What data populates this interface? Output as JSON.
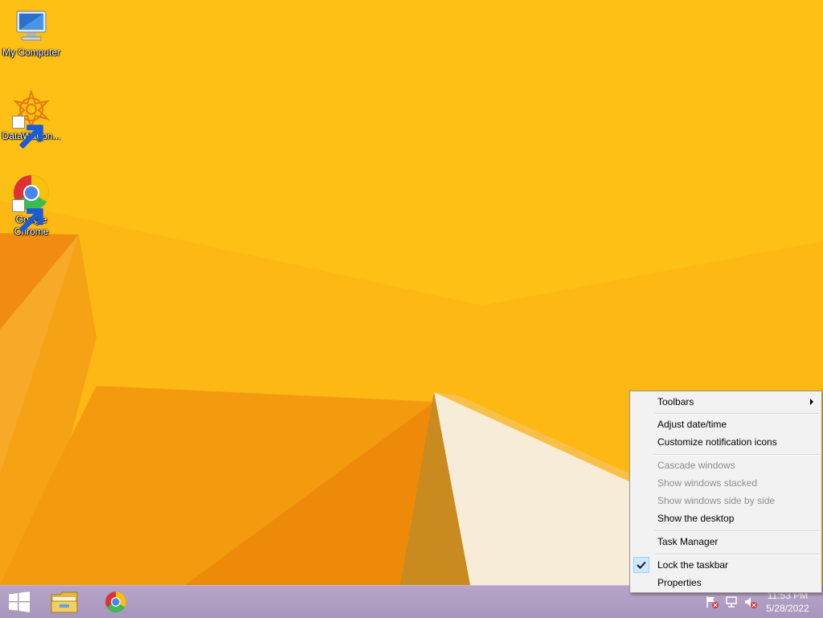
{
  "desktop": {
    "icons": [
      {
        "label": "My Computer",
        "icon": "computer-icon"
      },
      {
        "label": "DataWagon...",
        "icon": "datawagon-icon"
      },
      {
        "label": "Google Chrome",
        "icon": "chrome-icon"
      }
    ]
  },
  "taskbar": {
    "start_icon": "windows-start-icon",
    "pinned": [
      {
        "icon": "file-explorer-icon"
      },
      {
        "icon": "chrome-icon"
      }
    ],
    "tray": {
      "icons": [
        "action-center-flag-icon",
        "network-icon",
        "volume-muted-icon"
      ],
      "time": "11:53 PM",
      "date": "5/28/2022"
    }
  },
  "context_menu": {
    "items": [
      {
        "label": "Toolbars",
        "enabled": true,
        "submenu": true
      },
      {
        "label": "Adjust date/time",
        "enabled": true
      },
      {
        "label": "Customize notification icons",
        "enabled": true
      },
      {
        "label": "Cascade windows",
        "enabled": false
      },
      {
        "label": "Show windows stacked",
        "enabled": false
      },
      {
        "label": "Show windows side by side",
        "enabled": false
      },
      {
        "label": "Show the desktop",
        "enabled": true
      },
      {
        "label": "Task Manager",
        "enabled": true
      },
      {
        "label": "Lock the taskbar",
        "enabled": true,
        "checked": true
      },
      {
        "label": "Properties",
        "enabled": true
      }
    ]
  },
  "colors": {
    "wallpaper": "#fdb813",
    "taskbar": "#ab9ac0",
    "menu_background": "#f2f2f2",
    "disabled_text": "#8d8d8d"
  }
}
